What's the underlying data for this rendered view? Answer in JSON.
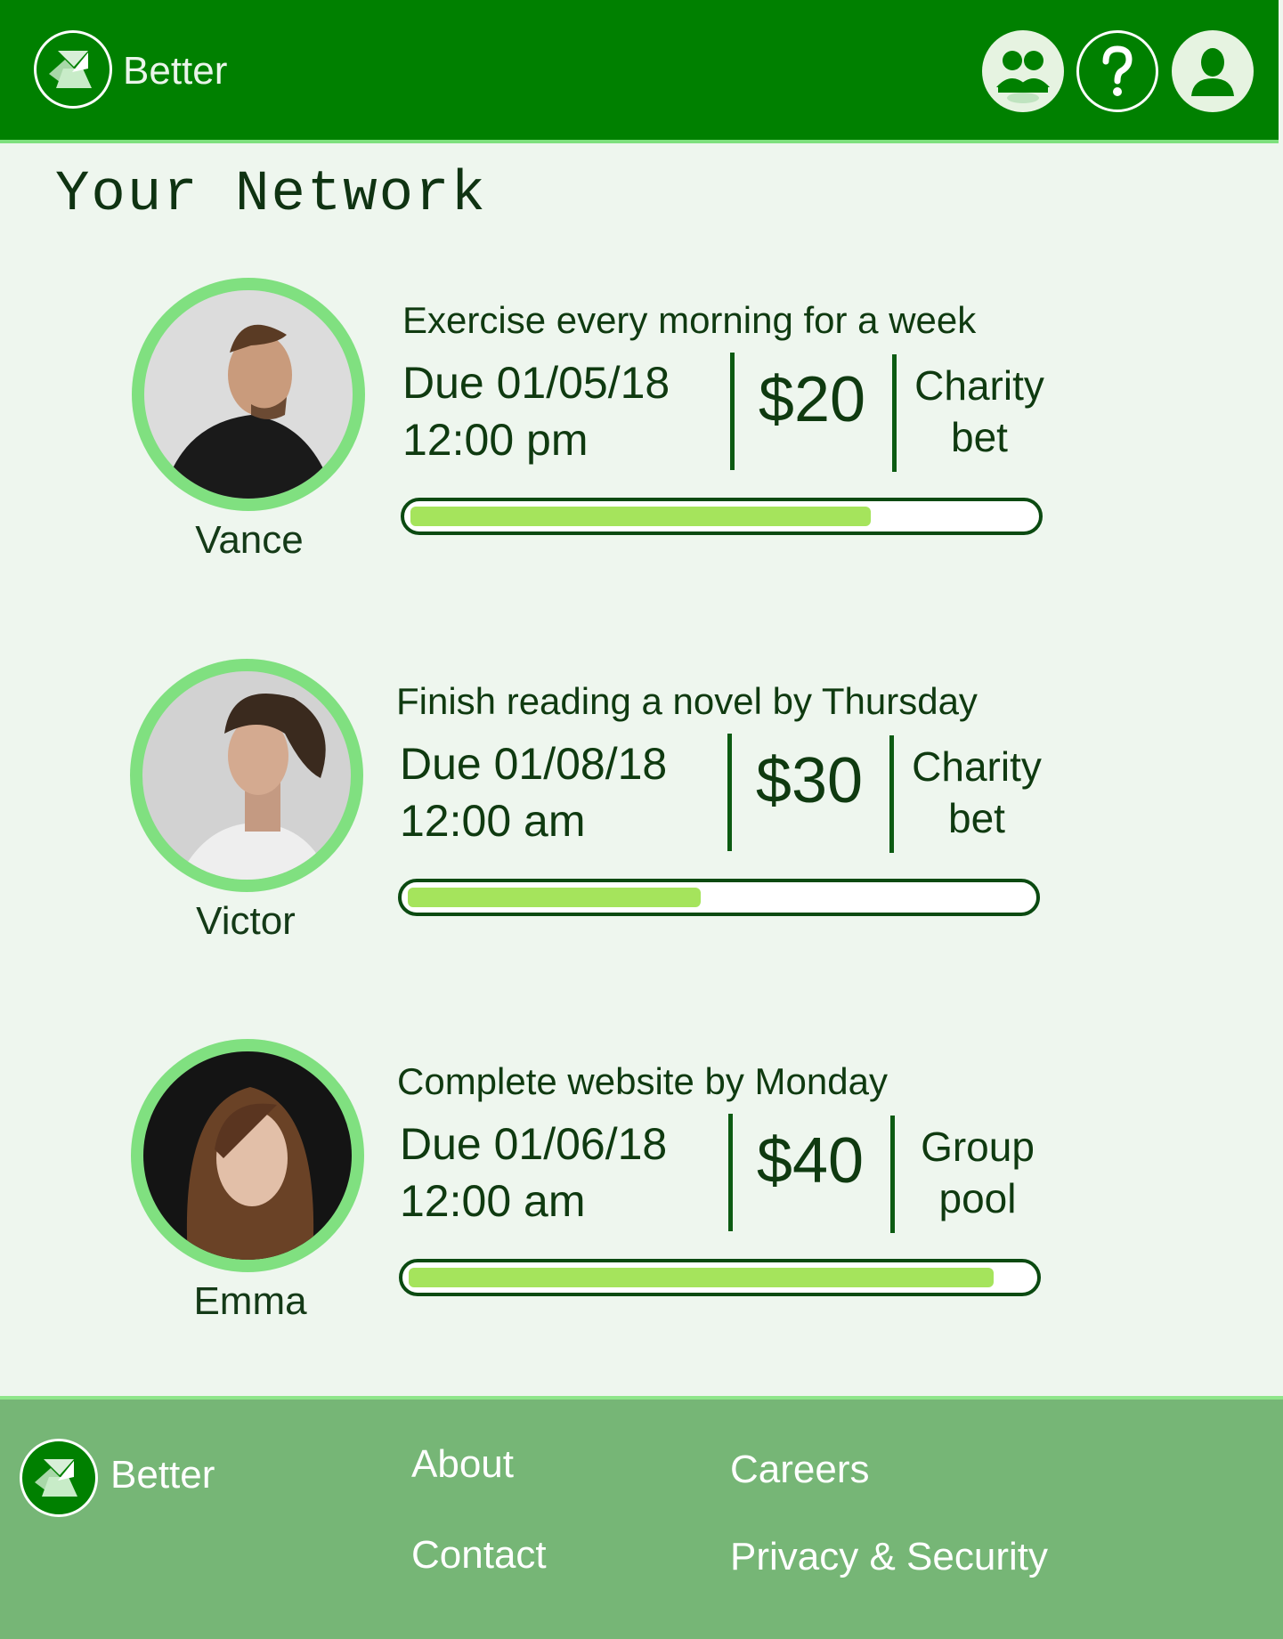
{
  "header": {
    "brand": "Better",
    "icons": [
      "network-icon",
      "help-icon",
      "profile-icon"
    ]
  },
  "page": {
    "title": "Your Network"
  },
  "network": [
    {
      "name": "Vance",
      "goal": "Exercise every morning for a week",
      "due_date": "Due 01/05/18",
      "due_time": "12:00 pm",
      "amount": "$20",
      "bet_type_line1": "Charity",
      "bet_type_line2": "bet",
      "progress": 0.74
    },
    {
      "name": "Victor",
      "goal": "Finish reading a novel by Thursday",
      "due_date": "Due 01/08/18",
      "due_time": "12:00 am",
      "amount": "$30",
      "bet_type_line1": "Charity",
      "bet_type_line2": "bet",
      "progress": 0.47
    },
    {
      "name": "Emma",
      "goal": "Complete website by Monday",
      "due_date": "Due 01/06/18",
      "due_time": "12:00 am",
      "amount": "$40",
      "bet_type_line1": "Group",
      "bet_type_line2": "pool",
      "progress": 0.94
    }
  ],
  "footer": {
    "brand": "Better",
    "about": "About",
    "contact": "Contact",
    "careers": "Careers",
    "privacy": "Privacy & Security"
  },
  "colors": {
    "header": "#008000",
    "accent": "#80e080",
    "progress_fill": "#a5e45c",
    "footer": "#76b676",
    "background": "#eef6ee"
  }
}
